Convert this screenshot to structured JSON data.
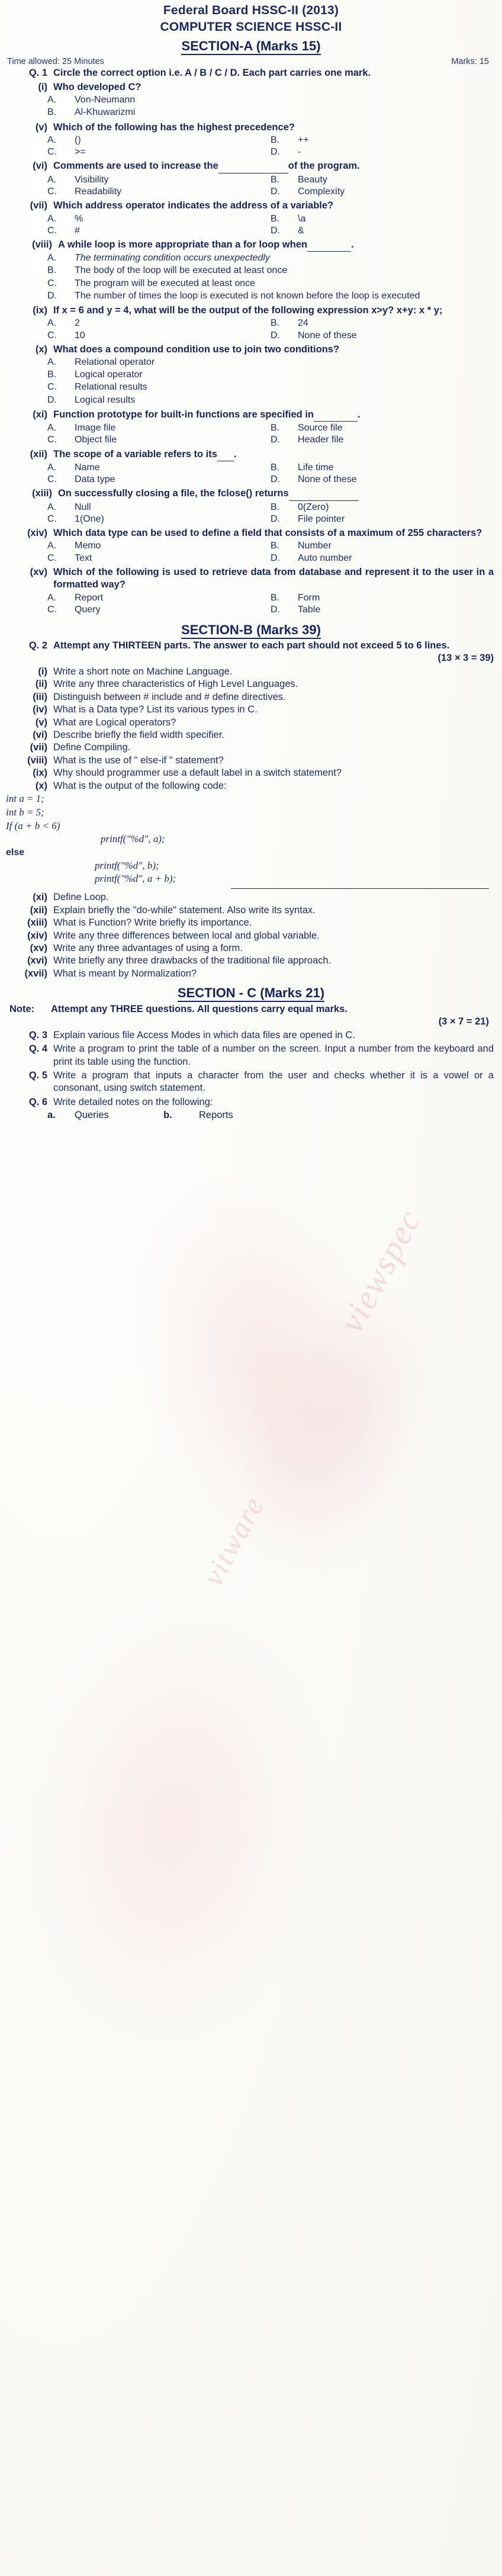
{
  "header": {
    "line1": "Federal Board HSSC-II (2013)",
    "line2": "COMPUTER SCIENCE HSSC-II",
    "section_a_title": "SECTION-A (Marks 15)",
    "time_allowed": "Time allowed: 25 Minutes",
    "marks": "Marks: 15"
  },
  "q1": {
    "label": "Q. 1",
    "text": "Circle the correct option i.e. A / B / C / D. Each part carries one mark."
  },
  "mcqs": [
    {
      "num": "(i)",
      "stem": "Who developed C?",
      "layout": "stack",
      "options": [
        {
          "letter": "A.",
          "text": "Von-Neumann"
        },
        {
          "letter": "B.",
          "text": "Al-Khuwarizmi"
        }
      ]
    },
    {
      "num": "(v)",
      "stem": "Which of the following has the highest precedence?",
      "layout": "grid",
      "options": [
        {
          "letter": "A.",
          "text": "()"
        },
        {
          "letter": "B.",
          "text": "++"
        },
        {
          "letter": "C.",
          "text": ">="
        },
        {
          "letter": "D.",
          "text": "-"
        }
      ]
    },
    {
      "num": "(vi)",
      "stem_pre": "Comments are used to increase the",
      "stem_post": "of the program.",
      "layout": "grid",
      "blank": "lg",
      "options": [
        {
          "letter": "A.",
          "text": "Visibility"
        },
        {
          "letter": "B.",
          "text": "Beauty"
        },
        {
          "letter": "C.",
          "text": "Readability"
        },
        {
          "letter": "D.",
          "text": "Complexity"
        }
      ]
    },
    {
      "num": "(vii)",
      "stem": "Which address operator indicates the address of a variable?",
      "layout": "grid",
      "options": [
        {
          "letter": "A.",
          "text": "%"
        },
        {
          "letter": "B.",
          "text": "\\a"
        },
        {
          "letter": "C.",
          "text": "#"
        },
        {
          "letter": "D.",
          "text": "&"
        }
      ]
    },
    {
      "num": "(viii)",
      "stem_pre": "A while loop is more appropriate than a for loop when",
      "stem_post": ".",
      "layout": "stack",
      "blank": "md",
      "options": [
        {
          "letter": "A.",
          "text": "The terminating condition occurs unexpectedly",
          "italic": true
        },
        {
          "letter": "B.",
          "text": "The body of the loop will be executed at least once"
        },
        {
          "letter": "C.",
          "text": "The program will be executed at least once"
        },
        {
          "letter": "D.",
          "text": "The number of times the loop is executed is not known before the loop is executed"
        }
      ]
    },
    {
      "num": "(ix)",
      "stem": "If x = 6 and y = 4, what will be the output of the following expression x>y?  x+y:   x * y;",
      "layout": "grid",
      "options": [
        {
          "letter": "A.",
          "text": "2"
        },
        {
          "letter": "B.",
          "text": "24"
        },
        {
          "letter": "C.",
          "text": "10"
        },
        {
          "letter": "D.",
          "text": "None of these"
        }
      ]
    },
    {
      "num": "(x)",
      "stem": "What does a compound condition use to join two conditions?",
      "layout": "stack",
      "options": [
        {
          "letter": "A.",
          "text": "Relational operator"
        },
        {
          "letter": "B.",
          "text": "Logical operator"
        },
        {
          "letter": "C.",
          "text": "Relational results"
        },
        {
          "letter": "D.",
          "text": "Logical results"
        }
      ]
    },
    {
      "num": "(xi)",
      "stem_pre": "Function prototype for built-in functions are specified in",
      "stem_post": ".",
      "layout": "grid",
      "blank": "md",
      "options": [
        {
          "letter": "A.",
          "text": "Image file"
        },
        {
          "letter": "B.",
          "text": "Source file"
        },
        {
          "letter": "C.",
          "text": "Object file"
        },
        {
          "letter": "D.",
          "text": "Header file"
        }
      ]
    },
    {
      "num": "(xii)",
      "stem_pre": "The scope of a variable refers to its",
      "stem_post": ".",
      "layout": "grid",
      "blank": "sm",
      "options": [
        {
          "letter": "A.",
          "text": "Name"
        },
        {
          "letter": "B.",
          "text": "Life time"
        },
        {
          "letter": "C.",
          "text": "Data type"
        },
        {
          "letter": "D.",
          "text": "None of these"
        }
      ]
    },
    {
      "num": "(xiii)",
      "stem_pre": "On successfully closing a file, the fclose() returns",
      "stem_post": "",
      "layout": "grid",
      "blank": "lg",
      "options": [
        {
          "letter": "A.",
          "text": "Null"
        },
        {
          "letter": "B.",
          "text": "0(Zero)"
        },
        {
          "letter": "C.",
          "text": "1(One)"
        },
        {
          "letter": "D.",
          "text": "File pointer"
        }
      ]
    },
    {
      "num": "(xiv)",
      "stem": "Which data type can be used to define a field that consists of a maximum of 255 characters?",
      "layout": "grid",
      "options": [
        {
          "letter": "A.",
          "text": "Memo"
        },
        {
          "letter": "B.",
          "text": "Number"
        },
        {
          "letter": "C.",
          "text": "Text"
        },
        {
          "letter": "D.",
          "text": "Auto number"
        }
      ]
    },
    {
      "num": "(xv)",
      "stem": "Which of the following is used to retrieve data from database and represent it to the user in a formatted way?",
      "layout": "grid",
      "options": [
        {
          "letter": "A.",
          "text": "Report"
        },
        {
          "letter": "B.",
          "text": "Form"
        },
        {
          "letter": "C.",
          "text": "Query"
        },
        {
          "letter": "D.",
          "text": "Table"
        }
      ]
    }
  ],
  "section_b": {
    "title": "SECTION-B (Marks 39)",
    "q2_label": "Q. 2",
    "q2_text": "Attempt any THIRTEEN parts. The answer to each part should not exceed 5 to 6 lines.",
    "q2_marks": "(13 × 3 = 39)",
    "parts": [
      {
        "num": "(i)",
        "text": "Write a short note on Machine Language."
      },
      {
        "num": "(ii)",
        "text": "Write any three characteristics of High Level Languages."
      },
      {
        "num": "(iii)",
        "text": "Distinguish between # include and # define directives."
      },
      {
        "num": "(iv)",
        "text": "What is a Data type? List its various types in C."
      },
      {
        "num": "(v)",
        "text": "What are Logical operators?"
      },
      {
        "num": "(vi)",
        "text": "Describe briefly the field width specifier."
      },
      {
        "num": "(vii)",
        "text": "Define Compiling."
      },
      {
        "num": "(viii)",
        "text": "What is the use of \" else-if \" statement?"
      },
      {
        "num": "(ix)",
        "text": "Why should programmer use a default label in a switch statement?"
      },
      {
        "num": "(x)",
        "text": "What is the output of the following code:"
      }
    ],
    "code": {
      "l1": "int a =  1;",
      "l2": "int b = 5;",
      "l3": "If (a + b < 6)",
      "l4": "printf(\"%d\", a);",
      "l5": "else",
      "l6": "printf(\"%d\", b);",
      "l7": "printf(\"%d\", a + b);"
    },
    "parts2": [
      {
        "num": "(xi)",
        "text": "Define Loop."
      },
      {
        "num": "(xii)",
        "text": "Explain briefly the \"do-while\" statement. Also write its syntax."
      },
      {
        "num": "(xiii)",
        "text": "What is Function? Write briefly its importance."
      },
      {
        "num": "(xiv)",
        "text": "Write any three differences between local and global variable."
      },
      {
        "num": "(xv)",
        "text": "Write any three advantages of using a form."
      },
      {
        "num": "(xvi)",
        "text": "Write briefly any three drawbacks of the traditional file approach."
      },
      {
        "num": "(xvii)",
        "text": "What is meant by Normalization?"
      }
    ]
  },
  "section_c": {
    "title": "SECTION - C (Marks 21)",
    "note_label": "Note:",
    "note_text": "Attempt any THREE questions. All questions carry equal marks.",
    "note_marks": "(3 × 7 = 21)",
    "questions": [
      {
        "num": "Q. 3",
        "text": "Explain various file Access Modes in which data files are opened in C."
      },
      {
        "num": "Q. 4",
        "text": "Write a program to print the table of a number on the screen. Input a number from the keyboard and print its table using the function."
      },
      {
        "num": "Q. 5",
        "text": "Write a program that inputs a character from the user and checks whether it is a vowel or a consonant, using switch statement."
      },
      {
        "num": "Q. 6",
        "text": "Write detailed notes on the following:"
      }
    ],
    "q6_sub": [
      {
        "letter": "a.",
        "text": "Queries"
      },
      {
        "letter": "b.",
        "text": "Reports"
      }
    ]
  },
  "watermark": {
    "text1": "viewspec",
    "text2": "vitware"
  }
}
